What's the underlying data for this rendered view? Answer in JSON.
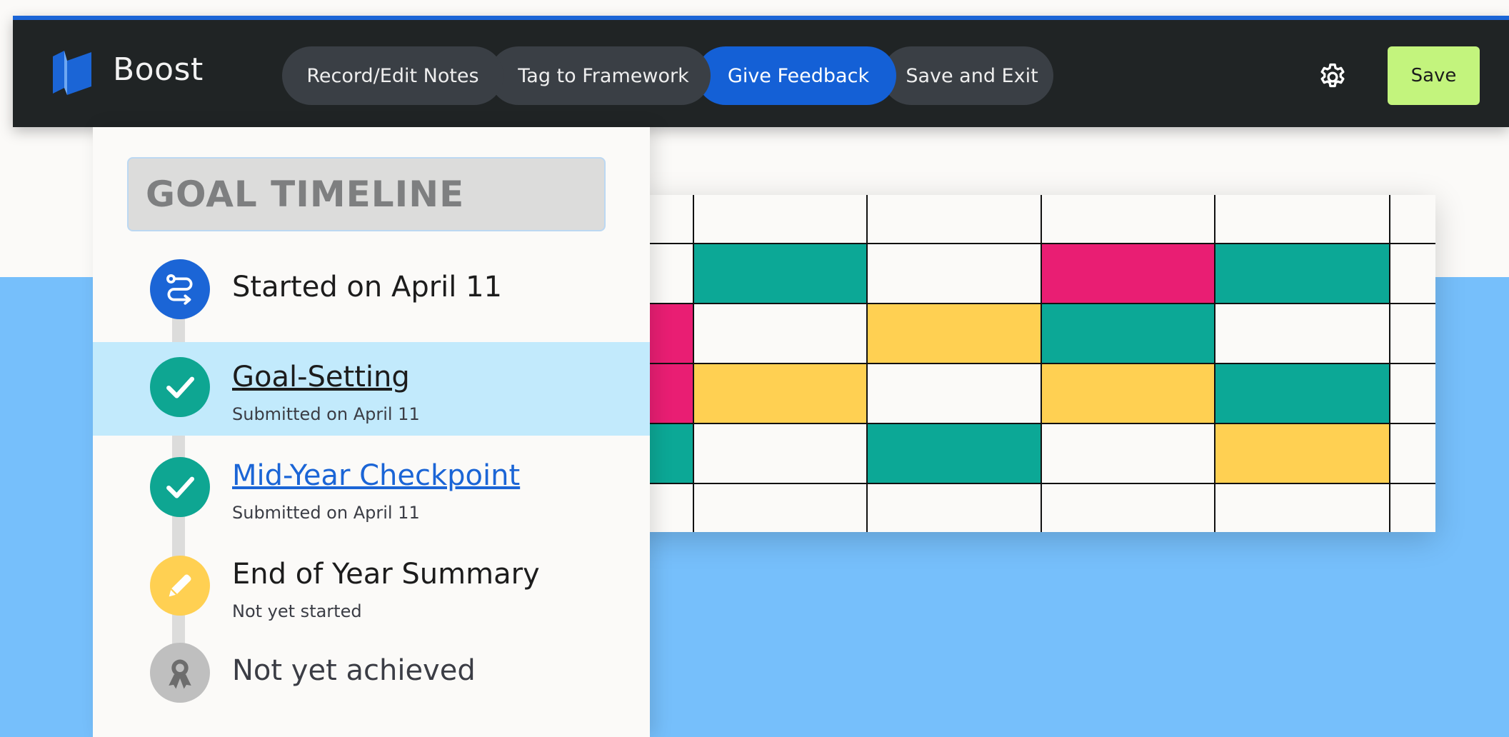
{
  "app": {
    "brand": "Boost"
  },
  "nav": {
    "tabs": [
      {
        "label": "Record/Edit Notes",
        "active": false
      },
      {
        "label": "Tag to Framework",
        "active": false
      },
      {
        "label": "Give Feedback",
        "active": true
      },
      {
        "label": "Save and Exit",
        "active": false
      }
    ],
    "settings_icon": "gear-icon",
    "save_label": "Save"
  },
  "timeline": {
    "title": "GOAL TIMELINE",
    "items": [
      {
        "label": "Started on April 11",
        "sub": "",
        "icon": "route-icon",
        "status_color": "#1b65d6"
      },
      {
        "label": "Goal-Setting",
        "sub": "Submitted on April 11",
        "icon": "check-icon",
        "status_color": "#0ea692",
        "selected": true
      },
      {
        "label": "Mid-Year Checkpoint",
        "sub": "Submitted on April 11",
        "icon": "check-icon",
        "status_color": "#0ea692"
      },
      {
        "label": "End of Year Summary",
        "sub": "Not yet started",
        "icon": "pencil-icon",
        "status_color": "#ffd052"
      },
      {
        "label": "Not yet achieved",
        "sub": "",
        "icon": "award-badge-icon",
        "status_color": "#bfbfbf"
      }
    ]
  },
  "colors": {
    "header_bg": "#202425",
    "accent_blue": "#1460d6",
    "save_green": "#c3f47d",
    "teal": "#0ca896",
    "pink": "#e91e73",
    "yellow": "#ffd052",
    "background_blue": "#76bffb"
  }
}
